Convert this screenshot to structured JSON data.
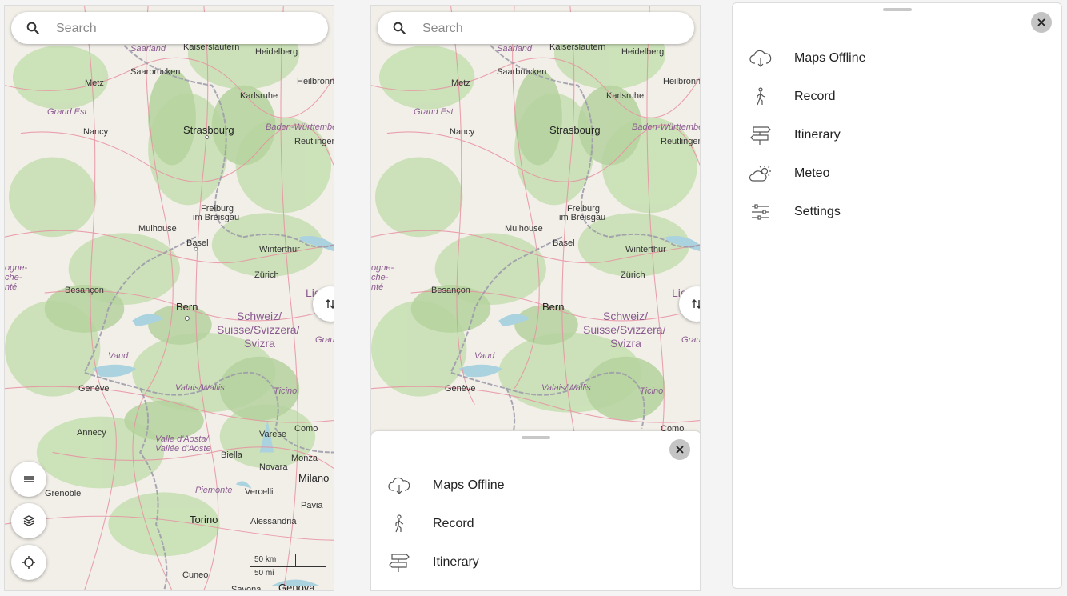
{
  "search": {
    "placeholder": "Search"
  },
  "map_labels": {
    "saarland": "Saarland",
    "kaiserslautern": "Kaiserslautern",
    "heidelberg": "Heidelberg",
    "metz": "Metz",
    "saarbrucken": "Saarbrücken",
    "heilbronn": "Heilbronn",
    "karlsruhe": "Karlsruhe",
    "grand_est": "Grand Est",
    "strasbourg": "Strasbourg",
    "baden": "Baden-Württemberg",
    "nancy": "Nancy",
    "reutlingen": "Reutlingen",
    "freiburg": "Freiburg",
    "im_breisgau": "im Breisgau",
    "mulhouse": "Mulhouse",
    "basel": "Basel",
    "winterthur": "Winterthur",
    "bourgogne1": "ogne-",
    "bourgogne2": "che-",
    "bourgogne3": "nté",
    "zurich": "Zürich",
    "besancon": "Besançon",
    "lie": "Lie",
    "bern": "Bern",
    "schweiz1": "Schweiz/",
    "schweiz2": "Suisse/Svizzera/",
    "schweiz3": "Svizra",
    "grau": "Grau",
    "vaud": "Vaud",
    "geneve": "Genève",
    "valais": "Valais/Wallis",
    "ticino": "Ticino",
    "annecy": "Annecy",
    "varese": "Varese",
    "como": "Como",
    "aosta1": "Valle d'Aosta/",
    "aosta2": "Vallée d'Aoste",
    "biella": "Biella",
    "monza": "Monza",
    "novara": "Novara",
    "milano": "Milano",
    "grenoble": "Grenoble",
    "piemonte": "Piemonte",
    "vercelli": "Vercelli",
    "pavia": "Pavia",
    "torino": "Torino",
    "alessandria": "Alessandria",
    "cuneo": "Cuneo",
    "savona": "Savona",
    "genova": "Genova"
  },
  "scale": {
    "km": "50 km",
    "mi": "50 mi"
  },
  "menu": {
    "items": [
      {
        "label": "Maps Offline",
        "icon": "cloud-download-icon"
      },
      {
        "label": "Record",
        "icon": "walking-person-icon"
      },
      {
        "label": "Itinerary",
        "icon": "signpost-icon"
      },
      {
        "label": "Meteo",
        "icon": "weather-partly-sunny-icon"
      },
      {
        "label": "Settings",
        "icon": "sliders-icon"
      }
    ]
  },
  "colors": {
    "map_land": "#f2efe9",
    "forest": "#add19e",
    "water": "#aad3df",
    "road": "#e892a2",
    "border": "#9e9cab"
  }
}
